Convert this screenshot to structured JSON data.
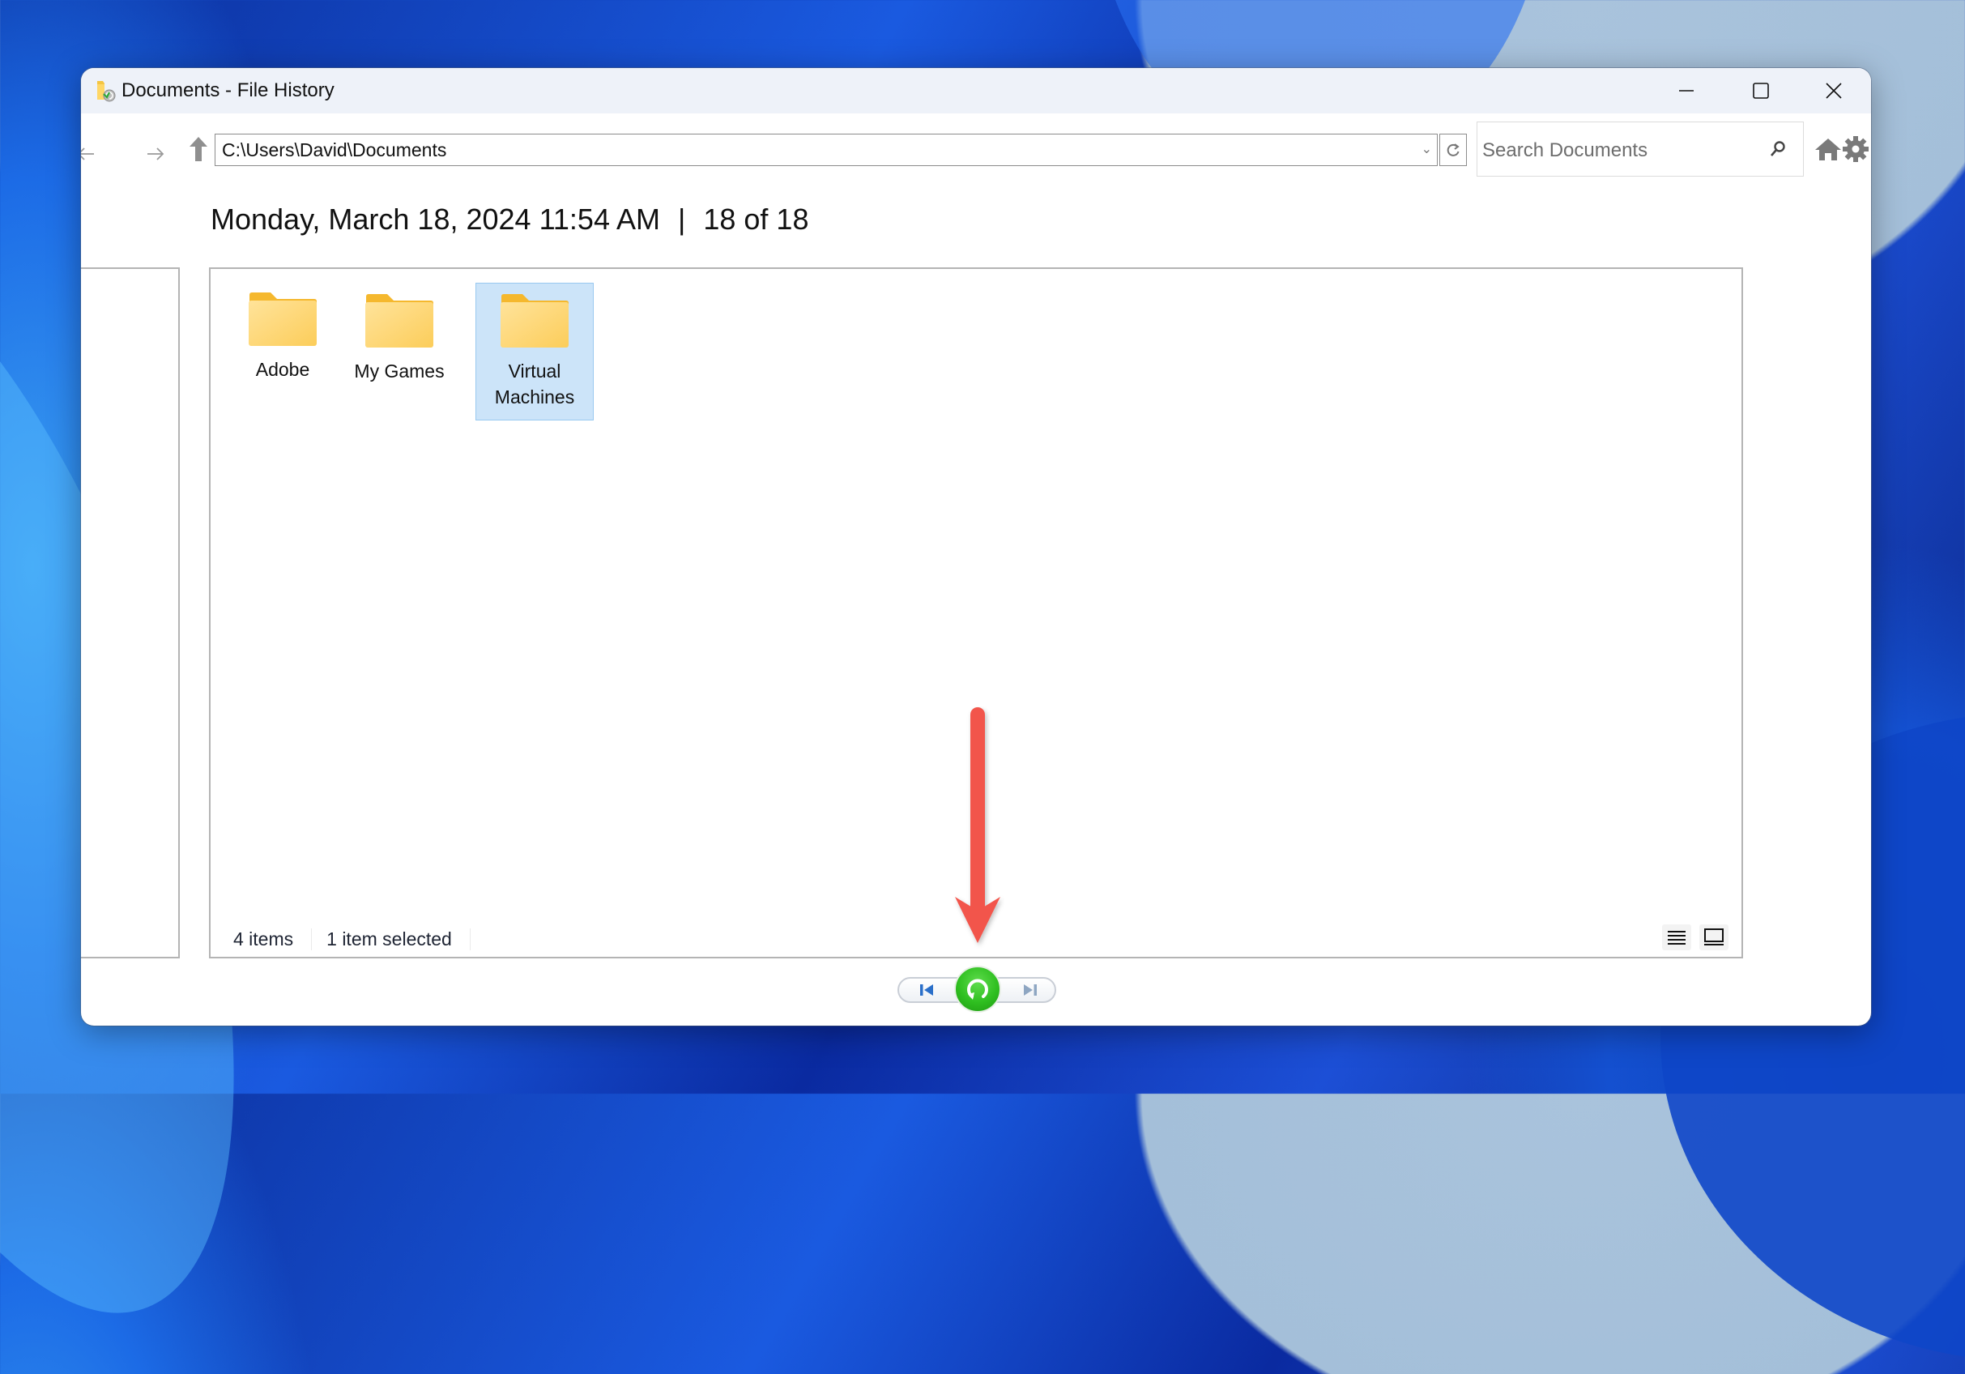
{
  "window": {
    "title": "Documents - File History",
    "controls": {
      "minimize": "minimize",
      "maximize": "maximize",
      "close": "close"
    }
  },
  "navigation": {
    "back_icon": "arrow-left-icon",
    "forward_icon": "arrow-right-icon",
    "up_icon": "arrow-up-icon",
    "address": "C:\\Users\\David\\Documents",
    "search_placeholder": "Search Documents"
  },
  "header": {
    "date": "Monday, March 18, 2024 11:54 AM",
    "separator": "|",
    "position": "18 of 18"
  },
  "items": [
    {
      "label": "Adobe",
      "type": "folder",
      "selected": false
    },
    {
      "label": "My Games",
      "type": "folder",
      "selected": false
    },
    {
      "label": "Virtual\nMachines",
      "label_line1": "Virtual",
      "label_line2": "Machines",
      "type": "folder",
      "selected": true
    }
  ],
  "status": {
    "item_count": "4 items",
    "selection": "1 item selected"
  },
  "view_modes": [
    "details",
    "large-icons"
  ],
  "playback": {
    "previous": "previous-version",
    "restore": "restore",
    "next": "next-version"
  },
  "colors": {
    "selection_bg": "#cce4f9",
    "restore_green": "#2fbf20",
    "annotation_red": "#f2554b",
    "folder_yellow": "#ffd766"
  }
}
